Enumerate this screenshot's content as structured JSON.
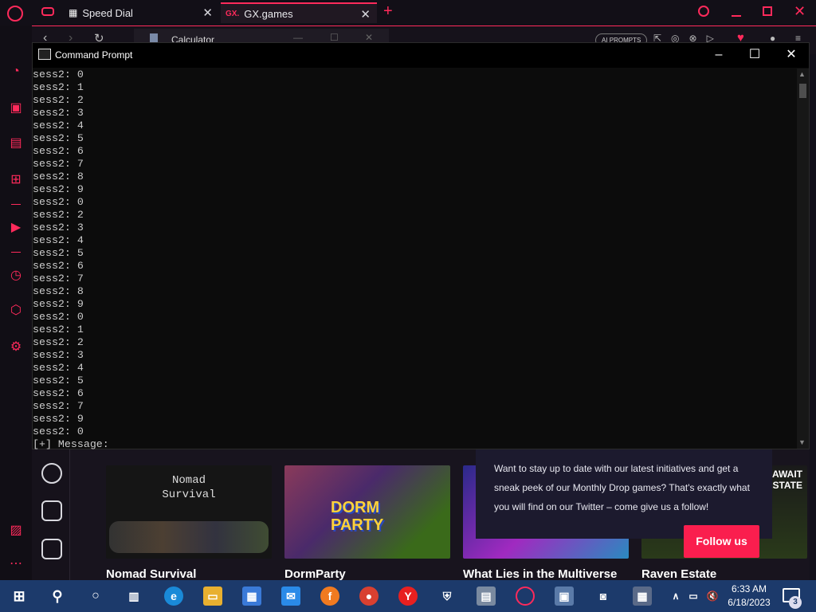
{
  "browser": {
    "tabs": [
      {
        "label": "Speed Dial",
        "active": false
      },
      {
        "label": "GX.games",
        "active": true
      }
    ],
    "gx_prefix": "GX.",
    "new_tab_symbol": "+",
    "aiprompts_label": "AI PROMPTS",
    "accent_color": "#ff2a5b"
  },
  "calculator_window": {
    "title": "Calculator"
  },
  "cmd": {
    "title": "Command Prompt",
    "lines": [
      "sess2: 0",
      "sess2: 1",
      "sess2: 2",
      "sess2: 3",
      "sess2: 4",
      "sess2: 5",
      "sess2: 6",
      "sess2: 7",
      "sess2: 8",
      "sess2: 9",
      "sess2: 0",
      "sess2: 2",
      "sess2: 3",
      "sess2: 4",
      "sess2: 5",
      "sess2: 6",
      "sess2: 7",
      "sess2: 8",
      "sess2: 9",
      "sess2: 0",
      "sess2: 1",
      "sess2: 2",
      "sess2: 3",
      "sess2: 4",
      "sess2: 5",
      "sess2: 6",
      "sess2: 7",
      "sess2: 9",
      "sess2: 0",
      "[+] Message:"
    ]
  },
  "games": {
    "cards": [
      {
        "title": "Nomad Survival",
        "art_text": "Nomad\nSurvival"
      },
      {
        "title": "DormParty",
        "art_text": "DORM PARTY"
      },
      {
        "title": "What Lies in the Multiverse",
        "art_text": ""
      },
      {
        "title": "Raven Estate",
        "art_text": "AWAIT\nESTATE"
      }
    ],
    "popup": {
      "text": "Want to stay up to date with our latest initiatives and get a sneak peek of our Monthly Drop games? That's exactly what you will find on our Twitter – come give us a follow!",
      "button": "Follow us"
    }
  },
  "taskbar": {
    "time": "6:33 AM",
    "date": "6/18/2023",
    "notification_count": "3",
    "color": "#1c3a6b"
  }
}
